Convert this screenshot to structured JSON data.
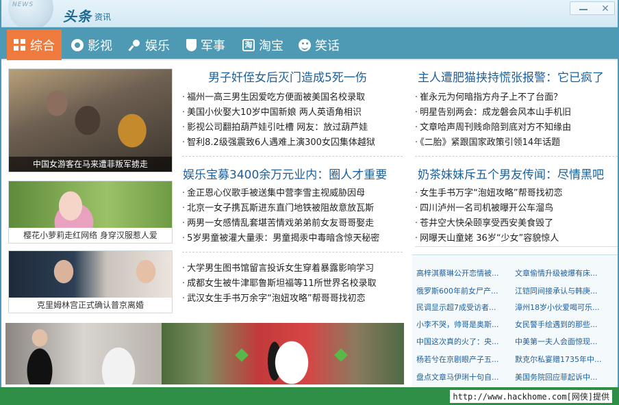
{
  "titlebar": {
    "globe_text": "NEWS",
    "logo": "头条",
    "sub": "资讯",
    "minimize": "",
    "close": "✕"
  },
  "nav": [
    {
      "label": "综合",
      "icon": "grid-icon",
      "active": true
    },
    {
      "label": "影视",
      "icon": "film-reel-icon"
    },
    {
      "label": "娱乐",
      "icon": "microphone-icon"
    },
    {
      "label": "军事",
      "icon": "shield-icon"
    },
    {
      "label": "淘宝",
      "icon": "taobao-icon"
    },
    {
      "label": "笑话",
      "icon": "smiley-icon"
    }
  ],
  "photos": [
    {
      "caption": "中国女游客在马来遭菲叛军掳走"
    },
    {
      "caption": "樱花小萝莉走红网络 身穿汉服惹人爱"
    },
    {
      "caption": "克里姆林宫正式确认普京离婚"
    }
  ],
  "middle": {
    "headline1": "男子奸侄女后灭门造成5死一伤",
    "list1": [
      "福州一高三男生因爱吃方便面被美国名校录取",
      "美国小伙娶大10岁中国新娘 两人英语角相识",
      "影视公司翻拍葫芦娃引吐槽 网友：放过葫芦娃",
      "智利8.2级强震致6人遇难上演300女囚集体越狱"
    ],
    "headline2": "娱乐宝募3400余万元业内：圈人才重要",
    "list2": [
      "金正恩心仪歌手被送集中营李雪主视威胁因母",
      "北京一女子携瓦斯进东直门地铁被阻故意放瓦斯",
      "两男一女感情乱套堪苦情戏弟弟前女友哥哥娶走",
      "5岁男童被灌大量汞：男童揭汞中毒暗含惊天秘密"
    ],
    "list3": [
      "大学男生图书馆留言投诉女生穿着暴露影响学习",
      "成都女生被牛津耶鲁斯坦福等11所世界名校录取",
      "武汉女生手书万余字“泡妞攻略”帮哥哥找初恋"
    ]
  },
  "right": {
    "headline1": "主人遭肥猫挟持慌张报警：它已疯了",
    "list1": [
      "崔永元为何暗指方舟子上不了台面？",
      "明星告别两会：成龙磐会风本山手机旧",
      "文章哈声周刊贱命陪到底对方不知缘由",
      "《二胎》紧跟国家政策引领14年话题"
    ],
    "headline2": "奶茶妹妹斥五个男友传闻：尽情黑吧",
    "list2": [
      "女生手书万字“泡妞攻略”帮哥找初恋",
      "四川泸州一名司机被曝开公车溜鸟",
      "苍井空大快朵颐享受西安美食毁了",
      "网曝天山童姥 36岁“少女”容貌惊人"
    ]
  },
  "links": [
    [
      "高梓淇蔡琳公开恋情被...",
      "文章偷情升级被爆有床..."
    ],
    [
      "俄罗斯600年前女尸产...",
      "江铠同间接承认与韩庚..."
    ],
    [
      "民调显示超7成受访者...",
      "漳州18岁小伙爱喝可乐..."
    ],
    [
      "小李不哭，帅哥是奥斯...",
      "女民警手绘遇到的那些..."
    ],
    [
      "中国这次真的火了：央...",
      "中美第一夫人会面惊现..."
    ],
    [
      "杨若兮在京剧眼产子五...",
      "默克尔私宴赠1735年中..."
    ],
    [
      "盘点文章马伊琍十句自...",
      "美国务院回应菲起诉中..."
    ]
  ],
  "status": {
    "text": "http://www.hackhome.com[网侠]提供"
  }
}
